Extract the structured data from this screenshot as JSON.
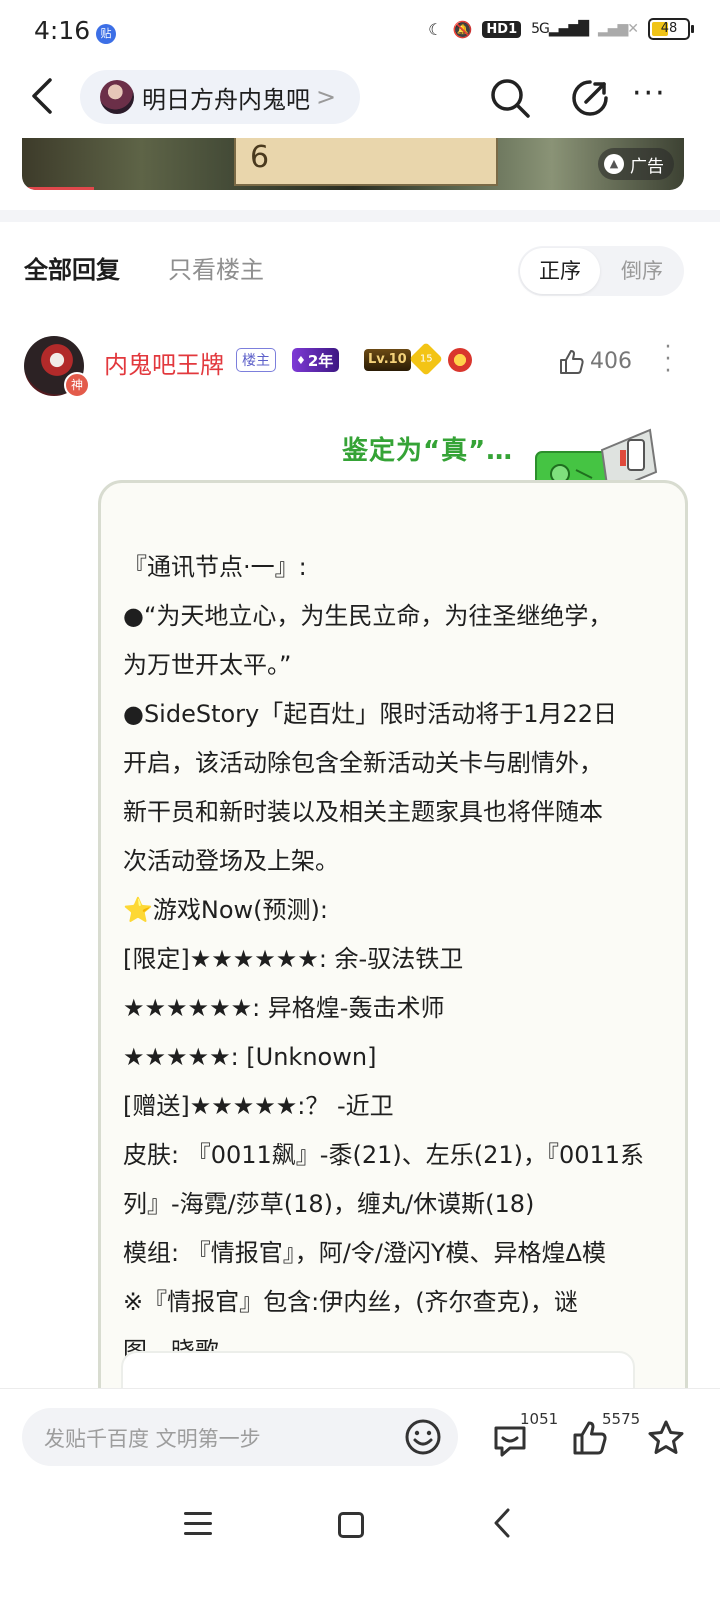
{
  "status_bar": {
    "time": "4:16",
    "app_badge": "贴",
    "network": "5G",
    "hd_label": "HD1",
    "battery": "48"
  },
  "nav": {
    "forum_name": "明日方舟内鬼吧",
    "chevron": ">",
    "more": "···"
  },
  "ad": {
    "label": "广告",
    "card_text": "6"
  },
  "filter": {
    "all_replies": "全部回复",
    "op_only": "只看楼主",
    "sort_asc": "正序",
    "sort_desc": "倒序"
  },
  "post": {
    "username": "内鬼吧王牌",
    "avatar_badge": "神",
    "op_badge": "楼主",
    "year_badge": "2年",
    "level_badge": "Lv.10",
    "gem_badge": "15",
    "like_count": "406",
    "sticker_caption": "鉴定为“真”…",
    "lines": [
      "『通讯节点·一』:",
      "●“为天地立心，为生民立命，为往圣继绝学，",
      "为万世开太平。”",
      "●SideStory「起百灶」限时活动将于1月22日",
      "开启，该活动除包含全新活动关卡与剧情外，",
      "新干员和新时装以及相关主题家具也将伴随本",
      "次活动登场及上架。",
      "⭐游戏Now(预测):",
      "[限定]★★★★★★: 余-驭法铁卫",
      "★★★★★★: 异格煌-轰击术师",
      "★★★★★: [Unknown]",
      "[赠送]★★★★★:？ -近卫",
      "皮肤: 『0011飙』-黍(21)、左乐(21)，『0011系",
      "列』-海霓/莎草(18)，缠丸/休谟斯(18)",
      "模组: 『情报官』，阿/令/澄闪Y模、异格煌Δ模",
      "※『情报官』包含:伊内丝，(齐尔查克)，谜",
      "图，晓歌"
    ]
  },
  "bottom_bar": {
    "input_placeholder": "发贴千百度 文明第一步",
    "reply_count": "1051",
    "like_count": "5575"
  }
}
